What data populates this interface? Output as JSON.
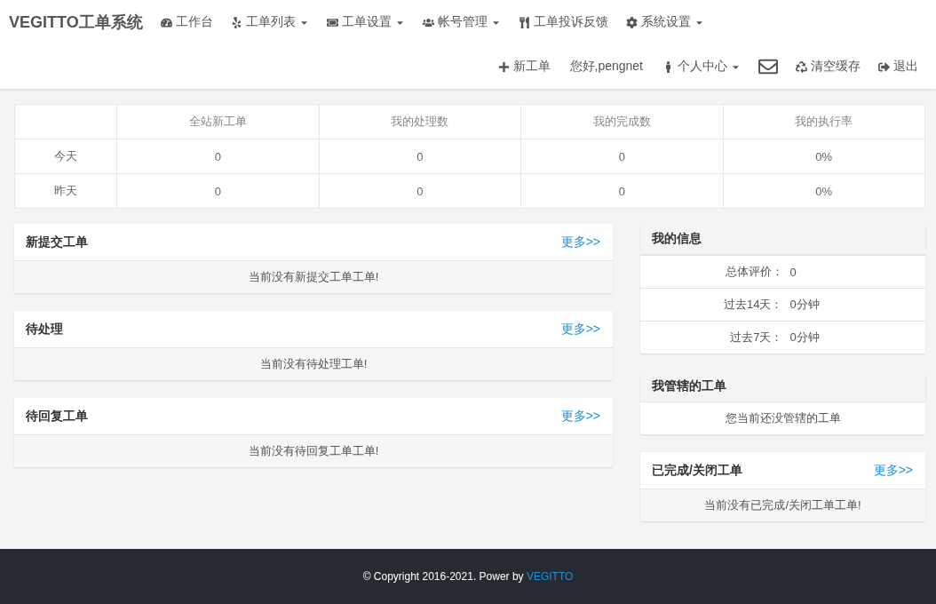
{
  "brand": "VEGITTO工单系统",
  "nav": [
    {
      "label": "工作台",
      "dropdown": false
    },
    {
      "label": "工单列表",
      "dropdown": true
    },
    {
      "label": "工单设置",
      "dropdown": true
    },
    {
      "label": "帐号管理",
      "dropdown": true
    },
    {
      "label": "工单投诉反馈",
      "dropdown": false
    },
    {
      "label": "系统设置",
      "dropdown": true
    }
  ],
  "user_bar": [
    {
      "kind": "link",
      "label": "新工单",
      "dropdown": false
    },
    {
      "kind": "text",
      "label": "您好,pengnet",
      "dropdown": false
    },
    {
      "kind": "link",
      "label": "个人中心",
      "dropdown": true
    },
    {
      "kind": "mail"
    },
    {
      "kind": "link",
      "label": "清空缓存",
      "dropdown": false
    },
    {
      "kind": "link",
      "label": "退出",
      "dropdown": false
    }
  ],
  "stats": {
    "columns": [
      "全站新工单",
      "我的处理数",
      "我的完成数",
      "我的执行率"
    ],
    "rows": [
      {
        "label": "今天",
        "cells": [
          "0",
          "0",
          "0",
          "0%"
        ]
      },
      {
        "label": "昨天",
        "cells": [
          "0",
          "0",
          "0",
          "0%"
        ]
      }
    ]
  },
  "left_panels": [
    {
      "title": "新提交工单",
      "more": "更多>>",
      "body": "当前没有新提交工单工单!"
    },
    {
      "title": "待处理",
      "more": "更多>>",
      "body": "当前没有待处理工单!"
    },
    {
      "title": "待回复工单",
      "more": "更多>>",
      "body": "当前没有待回复工单工单!"
    }
  ],
  "right_panels": [
    {
      "kind": "info",
      "title": "我的信息",
      "rows": [
        {
          "label": "总体评价：",
          "value": "0"
        },
        {
          "label": "过去14天：",
          "value": "0分钟"
        },
        {
          "label": "过去7天：",
          "value": "0分钟"
        }
      ]
    },
    {
      "kind": "note",
      "title": "我管辖的工单",
      "body": "您当前还没管辖的工单"
    },
    {
      "kind": "list",
      "title": "已完成/关闭工单",
      "more": "更多>>",
      "body": "当前没有已完成/关闭工单工单!"
    }
  ],
  "footer": {
    "text": "© Copyright 2016-2021. Power by ",
    "link": "VEGITTO"
  }
}
